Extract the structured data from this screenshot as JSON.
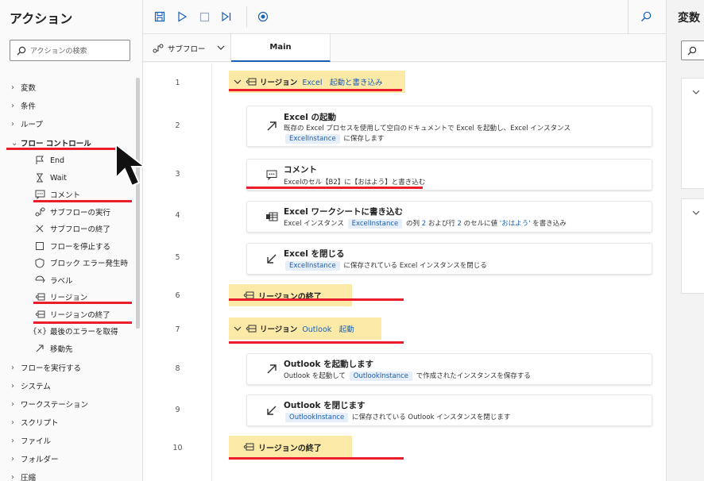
{
  "actions_panel": {
    "title": "アクション",
    "search_placeholder": "アクションの検索",
    "categories": [
      {
        "label": "変数"
      },
      {
        "label": "条件"
      },
      {
        "label": "ループ"
      },
      {
        "label": "フロー コントロール"
      },
      {
        "label": "フローを実行する"
      },
      {
        "label": "システム"
      },
      {
        "label": "ワークステーション"
      },
      {
        "label": "スクリプト"
      },
      {
        "label": "ファイル"
      },
      {
        "label": "フォルダー"
      },
      {
        "label": "圧縮"
      }
    ],
    "flow_control_items": [
      {
        "label": "End",
        "icon": "flag-icon"
      },
      {
        "label": "Wait",
        "icon": "hourglass-icon"
      },
      {
        "label": "コメント",
        "icon": "comment-icon"
      },
      {
        "label": "サブフローの実行",
        "icon": "subflow-icon"
      },
      {
        "label": "サブフローの終了",
        "icon": "x-icon"
      },
      {
        "label": "フローを停止する",
        "icon": "stop-icon"
      },
      {
        "label": "ブロック エラー発生時",
        "icon": "shield-icon"
      },
      {
        "label": "ラベル",
        "icon": "label-icon"
      },
      {
        "label": "リージョン",
        "icon": "region-icon"
      },
      {
        "label": "リージョンの終了",
        "icon": "region-end-icon"
      },
      {
        "label": "最後のエラーを取得",
        "icon": "error-var-icon"
      },
      {
        "label": "移動先",
        "icon": "goto-arrow-icon"
      }
    ]
  },
  "tabs": {
    "subflow_label": "サブフロー",
    "main_label": "Main"
  },
  "flow": {
    "line_numbers": [
      "1",
      "2",
      "3",
      "4",
      "5",
      "6",
      "7",
      "8",
      "9",
      "10"
    ],
    "region1": {
      "label": "リージョン",
      "arg": "Excel　起動と書き込み"
    },
    "region1_end": "リージョンの終了",
    "region2": {
      "label": "リージョン",
      "arg": "Outlook　起動"
    },
    "region2_end": "リージョンの終了",
    "actions": {
      "excel_launch": {
        "title": "Excel の起動",
        "desc_a": "既存の Excel プロセスを使用して空白のドキュメントで Excel を起動し、Excel インスタンス",
        "var": "ExcelInstance",
        "desc_b": "に保存します"
      },
      "comment": {
        "title": "コメント",
        "text": "Excelのセル【B2】に【おはよう】と書き込む"
      },
      "excel_write": {
        "title": "Excel ワークシートに書き込む",
        "desc_a": "Excel インスタンス",
        "var": "ExcelInstance",
        "desc_b": "の列",
        "col": "2",
        "desc_c": "および行",
        "row": "2",
        "desc_d": "のセルに値",
        "value": "'おはよう'",
        "desc_e": "を書き込み"
      },
      "excel_close": {
        "title": "Excel を閉じる",
        "var": "ExcelInstance",
        "desc": "に保存されている Excel インスタンスを閉じる"
      },
      "outlook_launch": {
        "title": "Outlook を起動します",
        "desc_a": "Outlook を起動して",
        "var": "OutlookInstance",
        "desc_b": "で作成されたインスタンスを保存する"
      },
      "outlook_close": {
        "title": "Outlook を閉じます",
        "var": "OutlookInstance",
        "desc": "に保存されている Outlook インスタンスを閉じます"
      }
    }
  },
  "vars_panel": {
    "title": "変数"
  },
  "colors": {
    "accent": "#1a5fb4",
    "region": "#fbe9a7",
    "highlight": "#ea1d2c"
  }
}
